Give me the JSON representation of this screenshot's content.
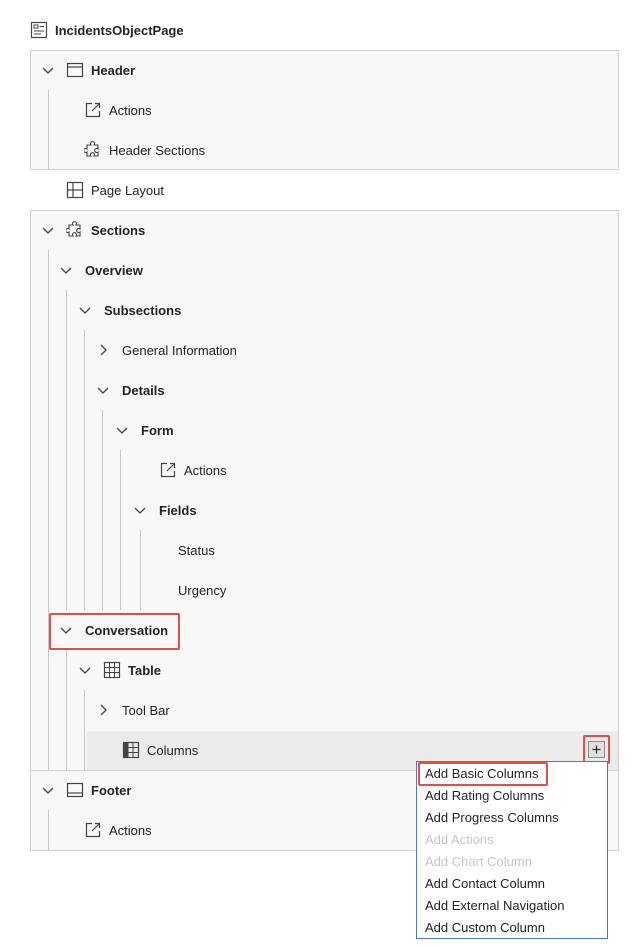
{
  "root": {
    "label": "IncidentsObjectPage",
    "icon": "object-page-icon"
  },
  "header": {
    "label": "Header",
    "icon": "header-layout-icon",
    "actions": {
      "label": "Actions",
      "icon": "external-link-icon"
    },
    "header_sections": {
      "label": "Header Sections",
      "icon": "puzzle-icon"
    }
  },
  "page_layout": {
    "label": "Page Layout",
    "icon": "layout-grid-icon"
  },
  "sections": {
    "label": "Sections",
    "icon": "puzzle-icon",
    "overview": {
      "label": "Overview",
      "subsections": {
        "label": "Subsections",
        "general_information": {
          "label": "General Information"
        },
        "details": {
          "label": "Details",
          "form": {
            "label": "Form",
            "actions": {
              "label": "Actions",
              "icon": "external-link-icon"
            },
            "fields": {
              "label": "Fields",
              "status": {
                "label": "Status"
              },
              "urgency": {
                "label": "Urgency"
              }
            }
          }
        }
      }
    },
    "conversation": {
      "label": "Conversation",
      "table": {
        "label": "Table",
        "icon": "table-icon",
        "tool_bar": {
          "label": "Tool Bar"
        },
        "columns": {
          "label": "Columns",
          "icon": "columns-icon",
          "add_icon": "plus-square-icon"
        }
      }
    }
  },
  "footer": {
    "label": "Footer",
    "icon": "footer-layout-icon",
    "actions": {
      "label": "Actions",
      "icon": "external-link-icon"
    }
  },
  "context_menu": {
    "items": [
      {
        "label": "Add Basic Columns",
        "enabled": true
      },
      {
        "label": "Add Rating Columns",
        "enabled": true
      },
      {
        "label": "Add Progress Columns",
        "enabled": true
      },
      {
        "label": "Add Actions",
        "enabled": false
      },
      {
        "label": "Add Chart Column",
        "enabled": false
      },
      {
        "label": "Add Contact Column",
        "enabled": true
      },
      {
        "label": "Add External Navigation",
        "enabled": true
      },
      {
        "label": "Add Custom Column",
        "enabled": true
      }
    ]
  },
  "colors": {
    "highlight": "#e74c4c",
    "menu_border": "#4a7bbd",
    "panel_bg": "#f8f8f8",
    "selected_row_bg": "#ebebeb",
    "disabled_text": "#c6c6c6"
  }
}
